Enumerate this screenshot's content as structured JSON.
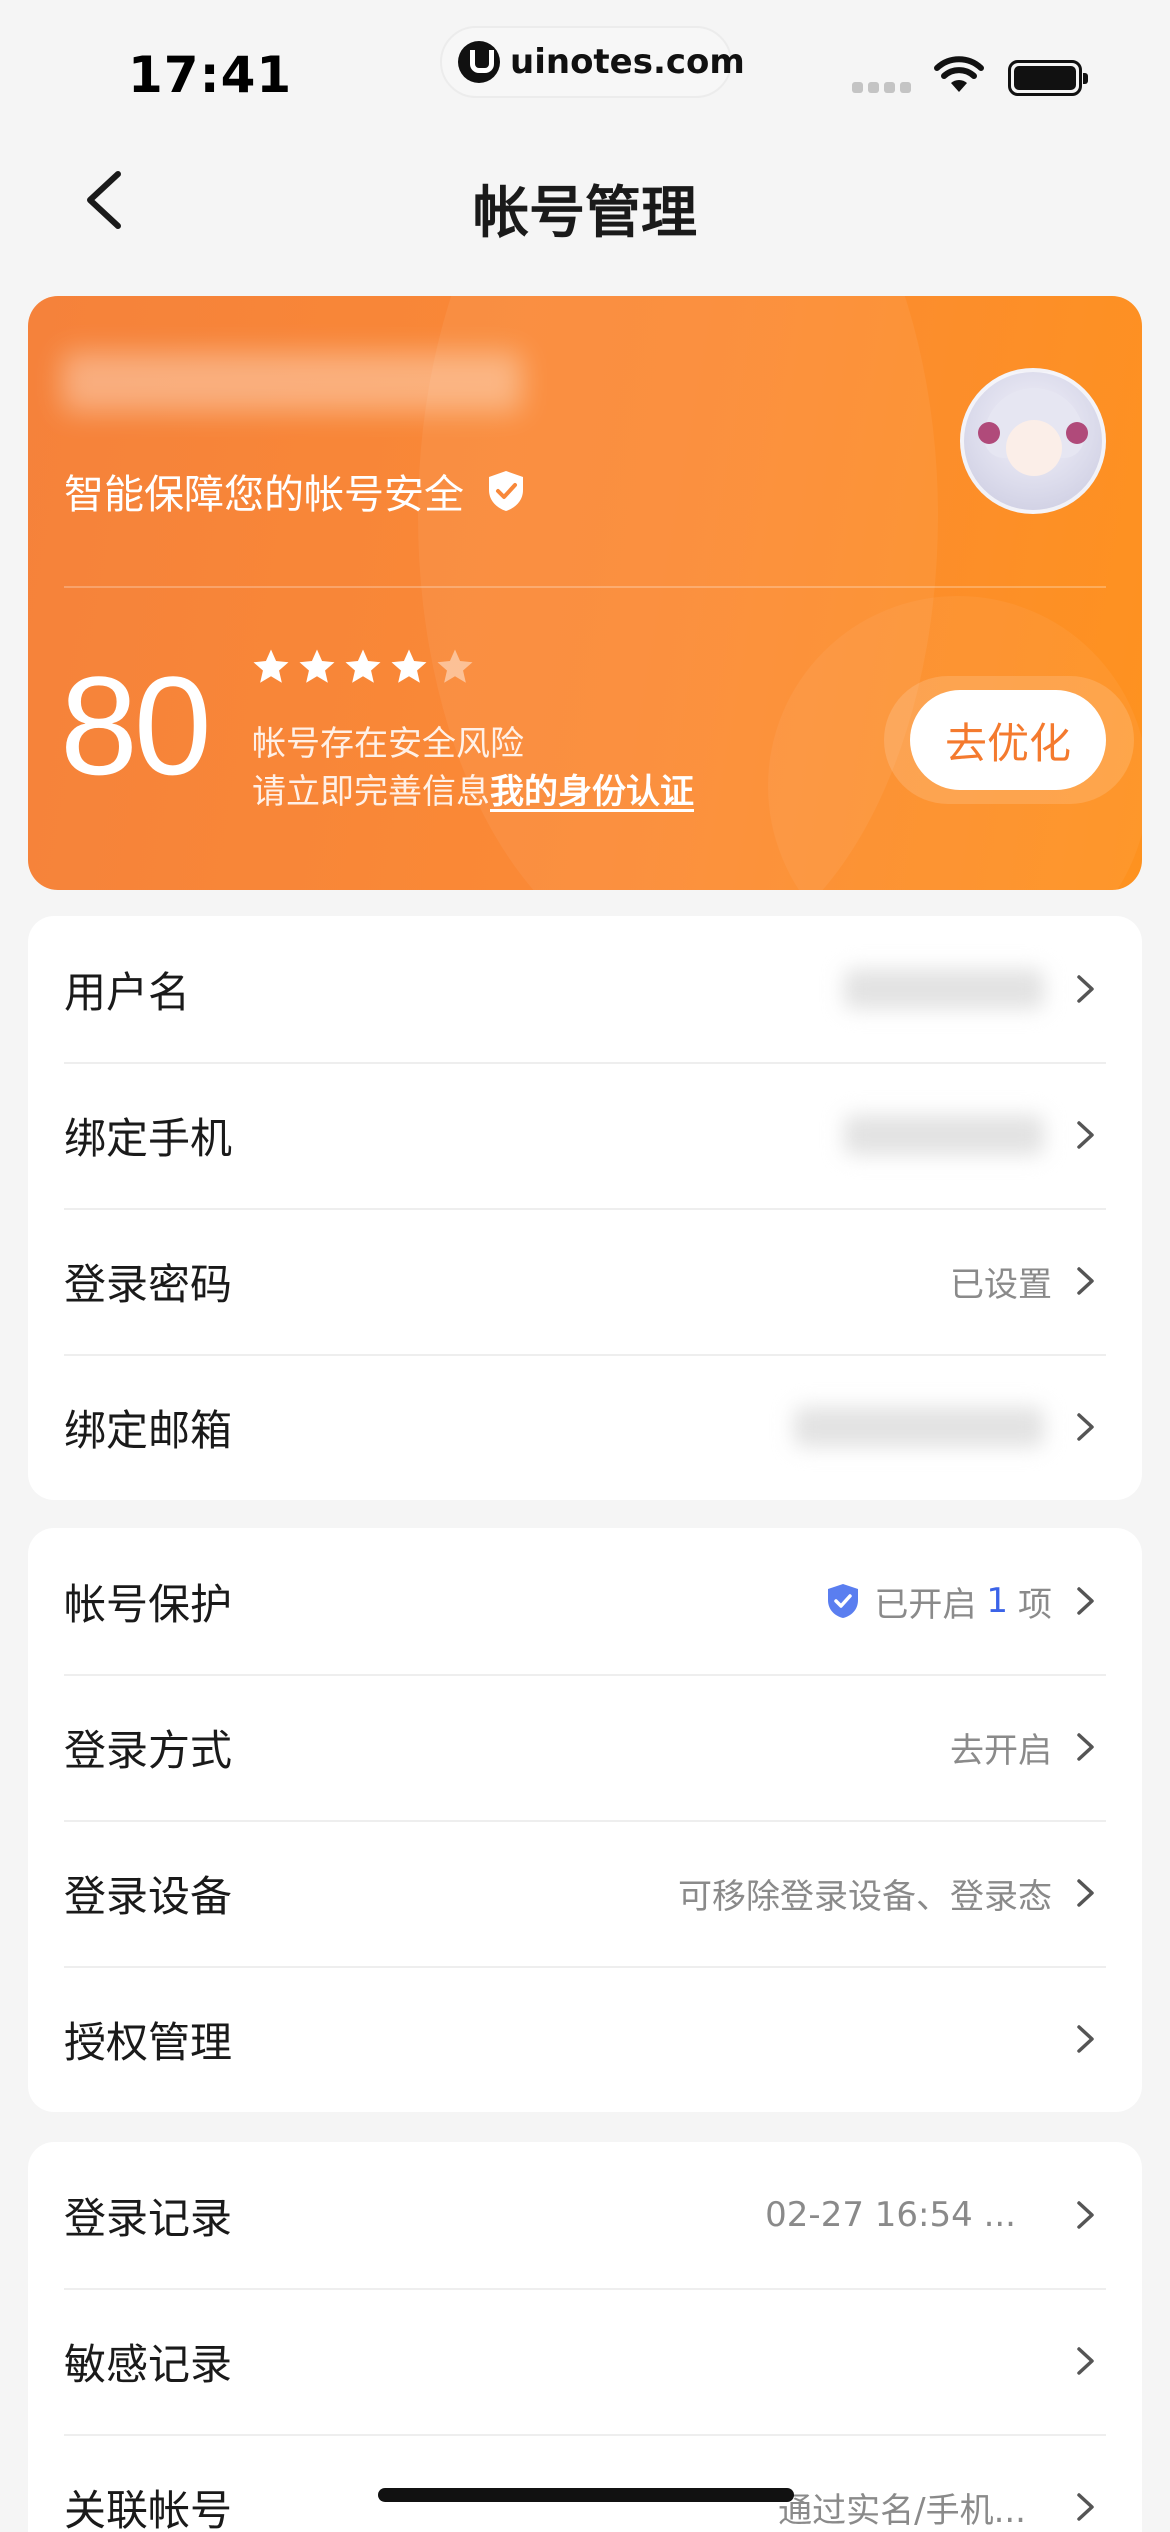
{
  "status_bar": {
    "time": "17:41",
    "url": "uinotes.com"
  },
  "nav": {
    "title": "帐号管理",
    "back_icon": "chevron-left-icon"
  },
  "security_card": {
    "subtitle": "智能保障您的帐号安全",
    "score": "80",
    "stars_filled": 4,
    "stars_total": 5,
    "risk_text": "帐号存在安全风险",
    "prompt_text": "请立即完善信息",
    "link_text": "我的身份认证",
    "button_label": "去优化",
    "colors": {
      "gradient_start": "#f5823b",
      "gradient_end": "#fe921f",
      "button_text": "#f47a2e"
    }
  },
  "groups": [
    {
      "rows": [
        {
          "label": "用户名",
          "value": "",
          "blurred": true
        },
        {
          "label": "绑定手机",
          "value": "",
          "blurred": true
        },
        {
          "label": "登录密码",
          "value": "已设置",
          "blurred": false
        },
        {
          "label": "绑定邮箱",
          "value": "",
          "blurred": true
        }
      ]
    },
    {
      "rows": [
        {
          "label": "帐号保护",
          "value_prefix": "已开启",
          "value_count": "1",
          "value_suffix": "项"
        },
        {
          "label": "登录方式",
          "value": "去开启"
        },
        {
          "label": "登录设备",
          "value": "可移除登录设备、登录态"
        },
        {
          "label": "授权管理",
          "value": ""
        }
      ]
    },
    {
      "rows": [
        {
          "label": "登录记录",
          "value": "02-27 16:54 ..."
        },
        {
          "label": "敏感记录",
          "value": ""
        },
        {
          "label": "关联帐号",
          "value": "通过实名/手机..."
        }
      ]
    }
  ]
}
